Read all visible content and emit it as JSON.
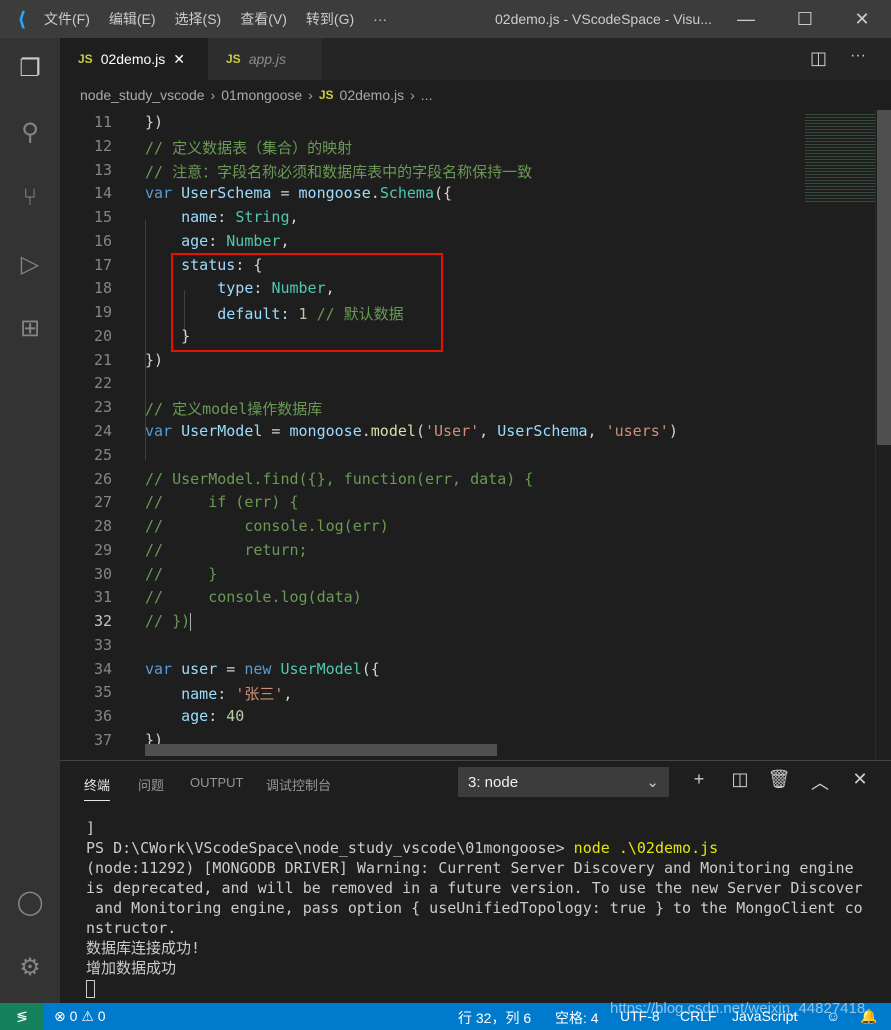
{
  "titlebar": {
    "menu": [
      "文件(F)",
      "编辑(E)",
      "选择(S)",
      "查看(V)",
      "转到(G)",
      "···"
    ],
    "window_title": "02demo.js - VScodeSpace - Visu...",
    "minimize": "—",
    "maximize": "☐",
    "close": "✕"
  },
  "activity_icons": [
    "explorer-icon",
    "search-icon",
    "source-control-icon",
    "run-debug-icon",
    "extensions-icon",
    "account-icon",
    "settings-gear-icon"
  ],
  "tabs": [
    {
      "label": "02demo.js",
      "badge": "JS",
      "active": true,
      "close": "✕"
    },
    {
      "label": "app.js",
      "badge": "JS",
      "active": false
    }
  ],
  "breadcrumb": {
    "items": [
      "node_study_vscode",
      "01mongoose",
      "02demo.js",
      "..."
    ],
    "file_badge": "JS"
  },
  "editor": {
    "current_line": 32,
    "lines": [
      {
        "n": 11,
        "t": [
          [
            "pl",
            "})"
          ]
        ]
      },
      {
        "n": 12,
        "t": [
          [
            "cm",
            "// 定义数据表（集合）的映射"
          ]
        ]
      },
      {
        "n": 13,
        "t": [
          [
            "cm",
            "// 注意：字段名称必须和数据库表中的字段名称保持一致"
          ]
        ]
      },
      {
        "n": 14,
        "t": [
          [
            "kw",
            "var "
          ],
          [
            "vr",
            "UserSchema"
          ],
          [
            "pl",
            " = "
          ],
          [
            "vr",
            "mongoose"
          ],
          [
            "pl",
            "."
          ],
          [
            "cl",
            "Schema"
          ],
          [
            "pl",
            "({"
          ]
        ]
      },
      {
        "n": 15,
        "t": [
          [
            "pl",
            "    "
          ],
          [
            "vr",
            "name"
          ],
          [
            "pl",
            ": "
          ],
          [
            "cl",
            "String"
          ],
          [
            "pl",
            ","
          ]
        ]
      },
      {
        "n": 16,
        "t": [
          [
            "pl",
            "    "
          ],
          [
            "vr",
            "age"
          ],
          [
            "pl",
            ": "
          ],
          [
            "cl",
            "Number"
          ],
          [
            "pl",
            ","
          ]
        ]
      },
      {
        "n": 17,
        "t": [
          [
            "pl",
            "    "
          ],
          [
            "vr",
            "status"
          ],
          [
            "pl",
            ": {"
          ]
        ]
      },
      {
        "n": 18,
        "t": [
          [
            "pl",
            "        "
          ],
          [
            "vr",
            "type"
          ],
          [
            "pl",
            ": "
          ],
          [
            "cl",
            "Number"
          ],
          [
            "pl",
            ","
          ]
        ]
      },
      {
        "n": 19,
        "t": [
          [
            "pl",
            "        "
          ],
          [
            "vr",
            "default"
          ],
          [
            "pl",
            ": "
          ],
          [
            "nu",
            "1"
          ],
          [
            "pl",
            " "
          ],
          [
            "cm",
            "// 默认数据"
          ]
        ]
      },
      {
        "n": 20,
        "t": [
          [
            "pl",
            "    }"
          ]
        ]
      },
      {
        "n": 21,
        "t": [
          [
            "pl",
            "})"
          ]
        ]
      },
      {
        "n": 22,
        "t": []
      },
      {
        "n": 23,
        "t": [
          [
            "cm",
            "// 定义model操作数据库"
          ]
        ]
      },
      {
        "n": 24,
        "t": [
          [
            "kw",
            "var "
          ],
          [
            "vr",
            "UserModel"
          ],
          [
            "pl",
            " = "
          ],
          [
            "vr",
            "mongoose"
          ],
          [
            "pl",
            "."
          ],
          [
            "fn",
            "model"
          ],
          [
            "pl",
            "("
          ],
          [
            "st",
            "'User'"
          ],
          [
            "pl",
            ", "
          ],
          [
            "vr",
            "UserSchema"
          ],
          [
            "pl",
            ", "
          ],
          [
            "st",
            "'users'"
          ],
          [
            "pl",
            ")"
          ]
        ]
      },
      {
        "n": 25,
        "t": []
      },
      {
        "n": 26,
        "t": [
          [
            "cm",
            "// UserModel.find({}, function(err, data) {"
          ]
        ]
      },
      {
        "n": 27,
        "t": [
          [
            "cm",
            "//     if (err) {"
          ]
        ]
      },
      {
        "n": 28,
        "t": [
          [
            "cm",
            "//         console.log(err)"
          ]
        ]
      },
      {
        "n": 29,
        "t": [
          [
            "cm",
            "//         return;"
          ]
        ]
      },
      {
        "n": 30,
        "t": [
          [
            "cm",
            "//     }"
          ]
        ]
      },
      {
        "n": 31,
        "t": [
          [
            "cm",
            "//     console.log(data)"
          ]
        ]
      },
      {
        "n": 32,
        "t": [
          [
            "cm",
            "// })"
          ]
        ]
      },
      {
        "n": 33,
        "t": []
      },
      {
        "n": 34,
        "t": [
          [
            "kw",
            "var "
          ],
          [
            "vr",
            "user"
          ],
          [
            "pl",
            " = "
          ],
          [
            "kw",
            "new "
          ],
          [
            "cl",
            "UserModel"
          ],
          [
            "pl",
            "({"
          ]
        ]
      },
      {
        "n": 35,
        "t": [
          [
            "pl",
            "    "
          ],
          [
            "vr",
            "name"
          ],
          [
            "pl",
            ": "
          ],
          [
            "st",
            "'张三'"
          ],
          [
            "pl",
            ","
          ]
        ]
      },
      {
        "n": 36,
        "t": [
          [
            "pl",
            "    "
          ],
          [
            "vr",
            "age"
          ],
          [
            "pl",
            ": "
          ],
          [
            "nu",
            "40"
          ]
        ]
      },
      {
        "n": 37,
        "t": [
          [
            "pl",
            "})"
          ]
        ]
      }
    ]
  },
  "panel": {
    "tabs": [
      "终端",
      "问题",
      "OUTPUT",
      "调试控制台"
    ],
    "active_tab": "终端",
    "terminal_select": "3: node",
    "icons": [
      "add-icon",
      "split-icon",
      "trash-icon",
      "maximize-chevron-up-icon",
      "close-icon"
    ],
    "terminal_lines": [
      "]",
      "PS D:\\CWork\\VScodeSpace\\node_study_vscode\\01mongoose> ",
      "(node:11292) [MONGODB DRIVER] Warning: Current Server Discovery and Monitoring engine",
      "is deprecated, and will be removed in a future version. To use the new Server Discover",
      " and Monitoring engine, pass option { useUnifiedTopology: true } to the MongoClient co",
      "nstructor.",
      "数据库连接成功!",
      "增加数据成功"
    ],
    "command": "node .\\02demo.js"
  },
  "statusbar": {
    "errors": "0",
    "warnings": "0",
    "position": "行 32，列 6",
    "indent": "空格: 4",
    "encoding": "UTF-8",
    "eol": "CRLF",
    "language": "JavaScript",
    "watermark": "https://blog.csdn.net/weixin_44827418"
  },
  "colors": {
    "accent": "#007acc",
    "remote": "#16825d",
    "highlight_box": "#e51400"
  }
}
